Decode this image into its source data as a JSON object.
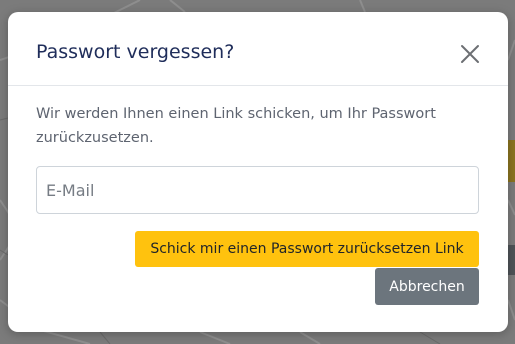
{
  "dialog": {
    "title": "Passwort vergessen?",
    "close_icon": "close-icon",
    "description": "Wir werden Ihnen einen Link schicken, um Ihr Passwort zurückzusetzen.",
    "email_input": {
      "placeholder": "E-Mail",
      "value": ""
    },
    "submit_label": "Schick mir einen Passwort zurücksetzen Link",
    "cancel_label": "Abbrechen"
  },
  "colors": {
    "title": "#1f2d5a",
    "primary_button": "#ffc20e",
    "secondary_button": "#6c757d",
    "backdrop": "#7b7b7b"
  }
}
